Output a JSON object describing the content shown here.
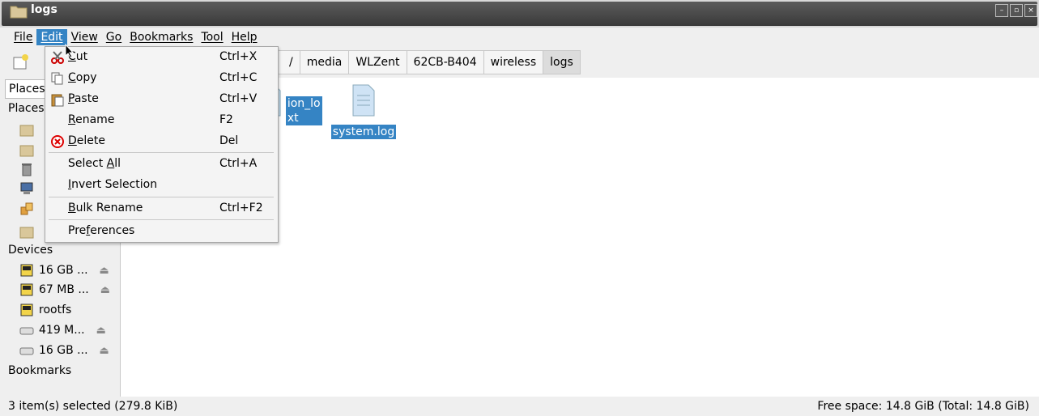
{
  "window": {
    "title": "logs",
    "controls": [
      "–",
      "▫",
      "×"
    ]
  },
  "menubar": [
    {
      "label": "File",
      "u": "F"
    },
    {
      "label": "Edit",
      "u": "E"
    },
    {
      "label": "View",
      "u": "V"
    },
    {
      "label": "Go",
      "u": "G"
    },
    {
      "label": "Bookmarks",
      "u": "B"
    },
    {
      "label": "Tool",
      "u": "T"
    },
    {
      "label": "Help",
      "u": "H"
    }
  ],
  "breadcrumb": [
    "/",
    "media",
    "WLZent",
    "62CB-B404",
    "wireless",
    "logs"
  ],
  "sidebar": {
    "selector": "Places",
    "places_heading": "Places",
    "devices_heading": "Devices",
    "devices": [
      "16 GB ...",
      "67 MB ...",
      "rootfs",
      "419 M...",
      "16 GB ..."
    ],
    "bookmarks_heading": "Bookmarks"
  },
  "files": [
    {
      "name": "ion_lo\nxt"
    },
    {
      "name": "system.log"
    }
  ],
  "edit_menu": {
    "items": [
      {
        "pre": "",
        "u": "C",
        "post": "ut",
        "shortcut": "Ctrl+X",
        "icon": "scissors-icon"
      },
      {
        "pre": "",
        "u": "C",
        "post": "opy",
        "shortcut": "Ctrl+C",
        "icon": "copy-icon"
      },
      {
        "pre": "",
        "u": "P",
        "post": "aste",
        "shortcut": "Ctrl+V",
        "icon": "paste-icon"
      },
      {
        "pre": "",
        "u": "R",
        "post": "ename",
        "shortcut": "F2",
        "icon": ""
      },
      {
        "pre": "",
        "u": "D",
        "post": "elete",
        "shortcut": "Del",
        "icon": "delete-icon"
      },
      {
        "pre": "Select ",
        "u": "A",
        "post": "ll",
        "shortcut": "Ctrl+A",
        "icon": ""
      },
      {
        "pre": "",
        "u": "I",
        "post": "nvert Selection",
        "shortcut": "",
        "icon": ""
      },
      {
        "pre": "",
        "u": "B",
        "post": "ulk Rename",
        "shortcut": "Ctrl+F2",
        "icon": ""
      },
      {
        "pre": "Pre",
        "u": "f",
        "post": "erences",
        "shortcut": "",
        "icon": ""
      }
    ]
  },
  "status": {
    "left": "3 item(s) selected (279.8 KiB)",
    "right": "Free space: 14.8 GiB (Total: 14.8 GiB)"
  },
  "colors": {
    "accent": "#3584c4",
    "chrome": "#efefef"
  }
}
